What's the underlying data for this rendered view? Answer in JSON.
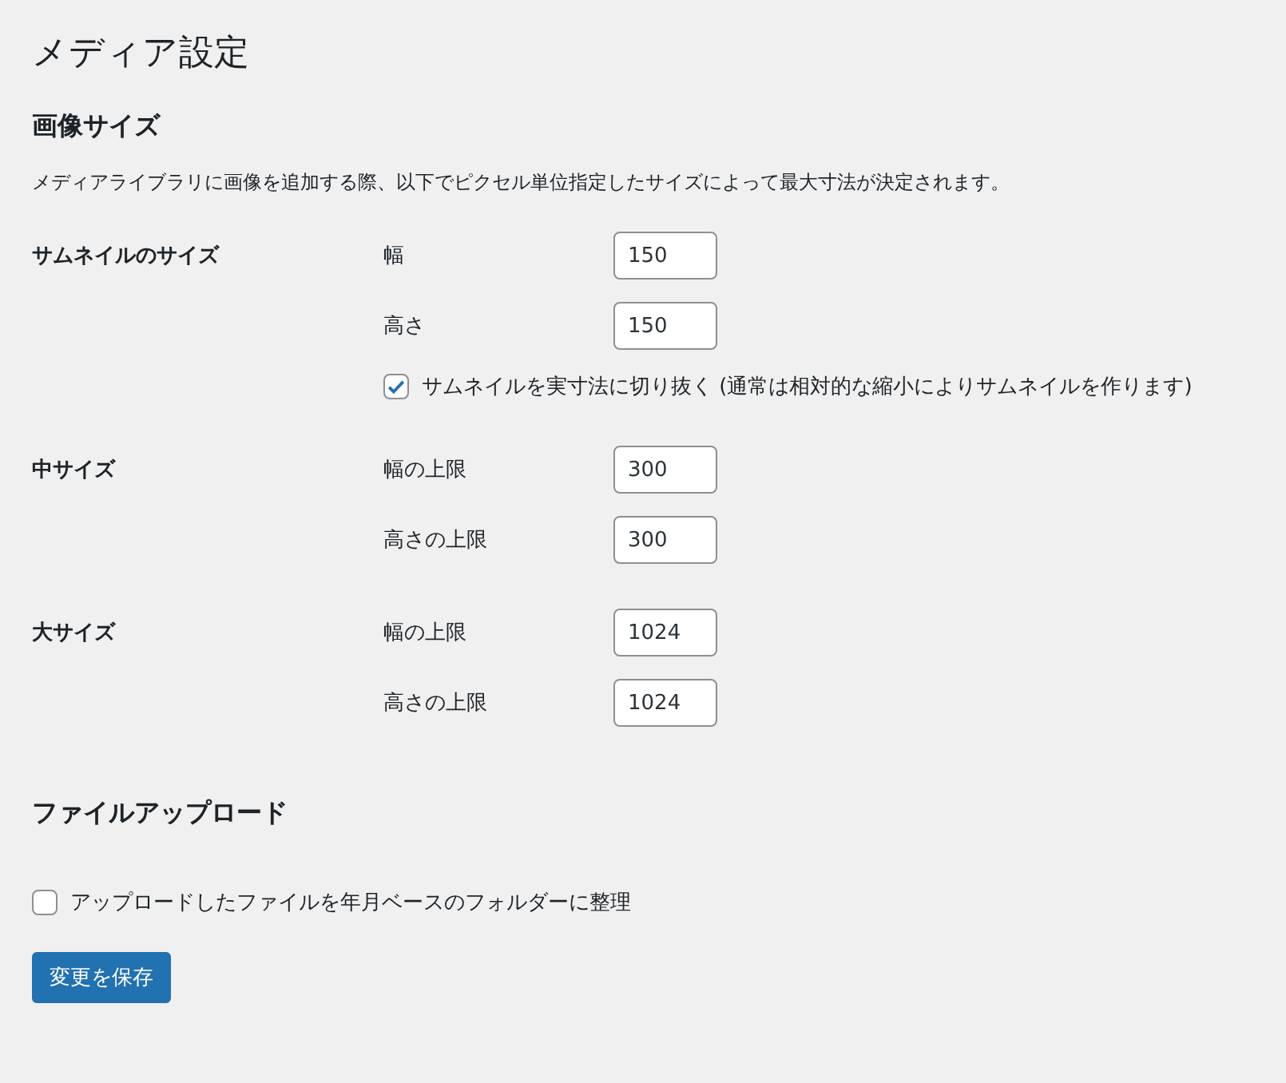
{
  "page_title": "メディア設定",
  "image_sizes": {
    "heading": "画像サイズ",
    "description": "メディアライブラリに画像を追加する際、以下でピクセル単位指定したサイズによって最大寸法が決定されます。",
    "groups": [
      {
        "label": "サムネイルのサイズ",
        "fields": [
          {
            "label": "幅",
            "value": "150"
          },
          {
            "label": "高さ",
            "value": "150"
          }
        ],
        "checkbox": {
          "label": "サムネイルを実寸法に切り抜く (通常は相対的な縮小によりサムネイルを作ります)",
          "checked": true
        }
      },
      {
        "label": "中サイズ",
        "fields": [
          {
            "label": "幅の上限",
            "value": "300"
          },
          {
            "label": "高さの上限",
            "value": "300"
          }
        ]
      },
      {
        "label": "大サイズ",
        "fields": [
          {
            "label": "幅の上限",
            "value": "1024"
          },
          {
            "label": "高さの上限",
            "value": "1024"
          }
        ]
      }
    ]
  },
  "file_upload": {
    "heading": "ファイルアップロード",
    "checkbox": {
      "label": "アップロードしたファイルを年月ベースのフォルダーに整理",
      "checked": false
    }
  },
  "save_button": "変更を保存"
}
